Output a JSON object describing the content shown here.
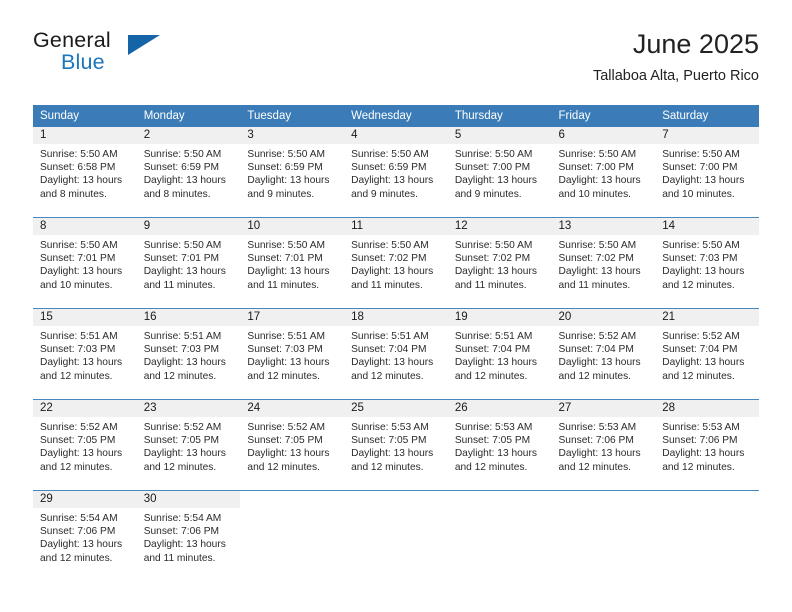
{
  "brand": {
    "name_part1": "General",
    "name_part2": "Blue",
    "flag_icon": "blue-triangle-flag-icon",
    "accent_color": "#1c76bc"
  },
  "header": {
    "title": "June 2025",
    "subtitle": "Tallaboa Alta, Puerto Rico"
  },
  "theme": {
    "header_row_bg": "#3b7cb8",
    "daynum_bg": "#f0f0f0",
    "row_divider": "#4a86c0",
    "text": "#2b2b2b"
  },
  "calendar": {
    "weekday_headers": [
      "Sunday",
      "Monday",
      "Tuesday",
      "Wednesday",
      "Thursday",
      "Friday",
      "Saturday"
    ],
    "weeks": [
      [
        {
          "day": "1",
          "sunrise": "Sunrise: 5:50 AM",
          "sunset": "Sunset: 6:58 PM",
          "daylight_line1": "Daylight: 13 hours",
          "daylight_line2": "and 8 minutes."
        },
        {
          "day": "2",
          "sunrise": "Sunrise: 5:50 AM",
          "sunset": "Sunset: 6:59 PM",
          "daylight_line1": "Daylight: 13 hours",
          "daylight_line2": "and 8 minutes."
        },
        {
          "day": "3",
          "sunrise": "Sunrise: 5:50 AM",
          "sunset": "Sunset: 6:59 PM",
          "daylight_line1": "Daylight: 13 hours",
          "daylight_line2": "and 9 minutes."
        },
        {
          "day": "4",
          "sunrise": "Sunrise: 5:50 AM",
          "sunset": "Sunset: 6:59 PM",
          "daylight_line1": "Daylight: 13 hours",
          "daylight_line2": "and 9 minutes."
        },
        {
          "day": "5",
          "sunrise": "Sunrise: 5:50 AM",
          "sunset": "Sunset: 7:00 PM",
          "daylight_line1": "Daylight: 13 hours",
          "daylight_line2": "and 9 minutes."
        },
        {
          "day": "6",
          "sunrise": "Sunrise: 5:50 AM",
          "sunset": "Sunset: 7:00 PM",
          "daylight_line1": "Daylight: 13 hours",
          "daylight_line2": "and 10 minutes."
        },
        {
          "day": "7",
          "sunrise": "Sunrise: 5:50 AM",
          "sunset": "Sunset: 7:00 PM",
          "daylight_line1": "Daylight: 13 hours",
          "daylight_line2": "and 10 minutes."
        }
      ],
      [
        {
          "day": "8",
          "sunrise": "Sunrise: 5:50 AM",
          "sunset": "Sunset: 7:01 PM",
          "daylight_line1": "Daylight: 13 hours",
          "daylight_line2": "and 10 minutes."
        },
        {
          "day": "9",
          "sunrise": "Sunrise: 5:50 AM",
          "sunset": "Sunset: 7:01 PM",
          "daylight_line1": "Daylight: 13 hours",
          "daylight_line2": "and 11 minutes."
        },
        {
          "day": "10",
          "sunrise": "Sunrise: 5:50 AM",
          "sunset": "Sunset: 7:01 PM",
          "daylight_line1": "Daylight: 13 hours",
          "daylight_line2": "and 11 minutes."
        },
        {
          "day": "11",
          "sunrise": "Sunrise: 5:50 AM",
          "sunset": "Sunset: 7:02 PM",
          "daylight_line1": "Daylight: 13 hours",
          "daylight_line2": "and 11 minutes."
        },
        {
          "day": "12",
          "sunrise": "Sunrise: 5:50 AM",
          "sunset": "Sunset: 7:02 PM",
          "daylight_line1": "Daylight: 13 hours",
          "daylight_line2": "and 11 minutes."
        },
        {
          "day": "13",
          "sunrise": "Sunrise: 5:50 AM",
          "sunset": "Sunset: 7:02 PM",
          "daylight_line1": "Daylight: 13 hours",
          "daylight_line2": "and 11 minutes."
        },
        {
          "day": "14",
          "sunrise": "Sunrise: 5:50 AM",
          "sunset": "Sunset: 7:03 PM",
          "daylight_line1": "Daylight: 13 hours",
          "daylight_line2": "and 12 minutes."
        }
      ],
      [
        {
          "day": "15",
          "sunrise": "Sunrise: 5:51 AM",
          "sunset": "Sunset: 7:03 PM",
          "daylight_line1": "Daylight: 13 hours",
          "daylight_line2": "and 12 minutes."
        },
        {
          "day": "16",
          "sunrise": "Sunrise: 5:51 AM",
          "sunset": "Sunset: 7:03 PM",
          "daylight_line1": "Daylight: 13 hours",
          "daylight_line2": "and 12 minutes."
        },
        {
          "day": "17",
          "sunrise": "Sunrise: 5:51 AM",
          "sunset": "Sunset: 7:03 PM",
          "daylight_line1": "Daylight: 13 hours",
          "daylight_line2": "and 12 minutes."
        },
        {
          "day": "18",
          "sunrise": "Sunrise: 5:51 AM",
          "sunset": "Sunset: 7:04 PM",
          "daylight_line1": "Daylight: 13 hours",
          "daylight_line2": "and 12 minutes."
        },
        {
          "day": "19",
          "sunrise": "Sunrise: 5:51 AM",
          "sunset": "Sunset: 7:04 PM",
          "daylight_line1": "Daylight: 13 hours",
          "daylight_line2": "and 12 minutes."
        },
        {
          "day": "20",
          "sunrise": "Sunrise: 5:52 AM",
          "sunset": "Sunset: 7:04 PM",
          "daylight_line1": "Daylight: 13 hours",
          "daylight_line2": "and 12 minutes."
        },
        {
          "day": "21",
          "sunrise": "Sunrise: 5:52 AM",
          "sunset": "Sunset: 7:04 PM",
          "daylight_line1": "Daylight: 13 hours",
          "daylight_line2": "and 12 minutes."
        }
      ],
      [
        {
          "day": "22",
          "sunrise": "Sunrise: 5:52 AM",
          "sunset": "Sunset: 7:05 PM",
          "daylight_line1": "Daylight: 13 hours",
          "daylight_line2": "and 12 minutes."
        },
        {
          "day": "23",
          "sunrise": "Sunrise: 5:52 AM",
          "sunset": "Sunset: 7:05 PM",
          "daylight_line1": "Daylight: 13 hours",
          "daylight_line2": "and 12 minutes."
        },
        {
          "day": "24",
          "sunrise": "Sunrise: 5:52 AM",
          "sunset": "Sunset: 7:05 PM",
          "daylight_line1": "Daylight: 13 hours",
          "daylight_line2": "and 12 minutes."
        },
        {
          "day": "25",
          "sunrise": "Sunrise: 5:53 AM",
          "sunset": "Sunset: 7:05 PM",
          "daylight_line1": "Daylight: 13 hours",
          "daylight_line2": "and 12 minutes."
        },
        {
          "day": "26",
          "sunrise": "Sunrise: 5:53 AM",
          "sunset": "Sunset: 7:05 PM",
          "daylight_line1": "Daylight: 13 hours",
          "daylight_line2": "and 12 minutes."
        },
        {
          "day": "27",
          "sunrise": "Sunrise: 5:53 AM",
          "sunset": "Sunset: 7:06 PM",
          "daylight_line1": "Daylight: 13 hours",
          "daylight_line2": "and 12 minutes."
        },
        {
          "day": "28",
          "sunrise": "Sunrise: 5:53 AM",
          "sunset": "Sunset: 7:06 PM",
          "daylight_line1": "Daylight: 13 hours",
          "daylight_line2": "and 12 minutes."
        }
      ],
      [
        {
          "day": "29",
          "sunrise": "Sunrise: 5:54 AM",
          "sunset": "Sunset: 7:06 PM",
          "daylight_line1": "Daylight: 13 hours",
          "daylight_line2": "and 12 minutes."
        },
        {
          "day": "30",
          "sunrise": "Sunrise: 5:54 AM",
          "sunset": "Sunset: 7:06 PM",
          "daylight_line1": "Daylight: 13 hours",
          "daylight_line2": "and 11 minutes."
        },
        null,
        null,
        null,
        null,
        null
      ]
    ]
  }
}
